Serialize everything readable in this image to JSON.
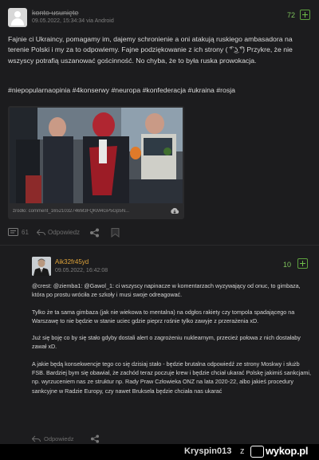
{
  "comment": {
    "username": "konto usunięte",
    "meta": "09.05.2022, 15:34:34  via Android",
    "score": "72",
    "text": "Fajnie ci Ukraincy, pomagamy im, dajemy schronienie a oni atakują ruskiego ambasadora na terenie Polski i my za to odpowiemy. Fajne podziękowanie z ich strony ( ͡° ͜ʖ ͡°) Przykre, że nie wszyscy potrafią uszanować gościnność. No chyba, że to była ruska prowokacja.",
    "tags": "#niepopularnaopinia #4konserwy #neuropa #konfederacja #ukraina #rosja",
    "embed_source": "źródło: comment_16521032746M3FQKM4GP5Gp5N...",
    "reply_count": "61",
    "reply_label": "Odpowiedz"
  },
  "reply": {
    "username": "Aik32fr45yd",
    "meta": "09.05.2022, 16:42:08",
    "score": "10",
    "paragraphs": [
      "@crest: @ziemba1: @Gawol_1: ci wszyscy napinacze w komentarzach wyzywający od onuc, to gimbaza, która po prostu wróciła ze szkoły i musi swoje odreagować.",
      "Tylko że ta sama gimbaza (jak nie wiekowa to mentalna) na odgłos rakiety czy tompola spadającego na Warszawę to nie będzie w stanie uciec gdzie pieprz rośnie tylko zawyje z przerażenia xD.",
      "Już się boję co by się stało gdyby dostali alert o zagrożeniu nuklearnym, przecież połowa z nich dostałaby zawał xD.",
      "A jakie będą konsekwencje tego co się dzisiaj stało - będzie brutalna odpowiedź ze strony Moskwy i służb FSB. Bardziej bym się obawiał, że zachód teraz poczuje krew i będzie chciał ukarać Polskę jakimiś sankcjami, np. wyrzuceniem nas ze struktur np. Rady Praw Człowieka ONZ na lata 2020-22, albo jakieś procedury sankcyjne w Radzie Europy, czy nawet Bruksela będzie chciała nas ukarać"
    ],
    "reply_label": "Odpowiedz"
  },
  "footer": {
    "username": "Kryspin013",
    "z": "z",
    "logo": "wykop.pl"
  }
}
